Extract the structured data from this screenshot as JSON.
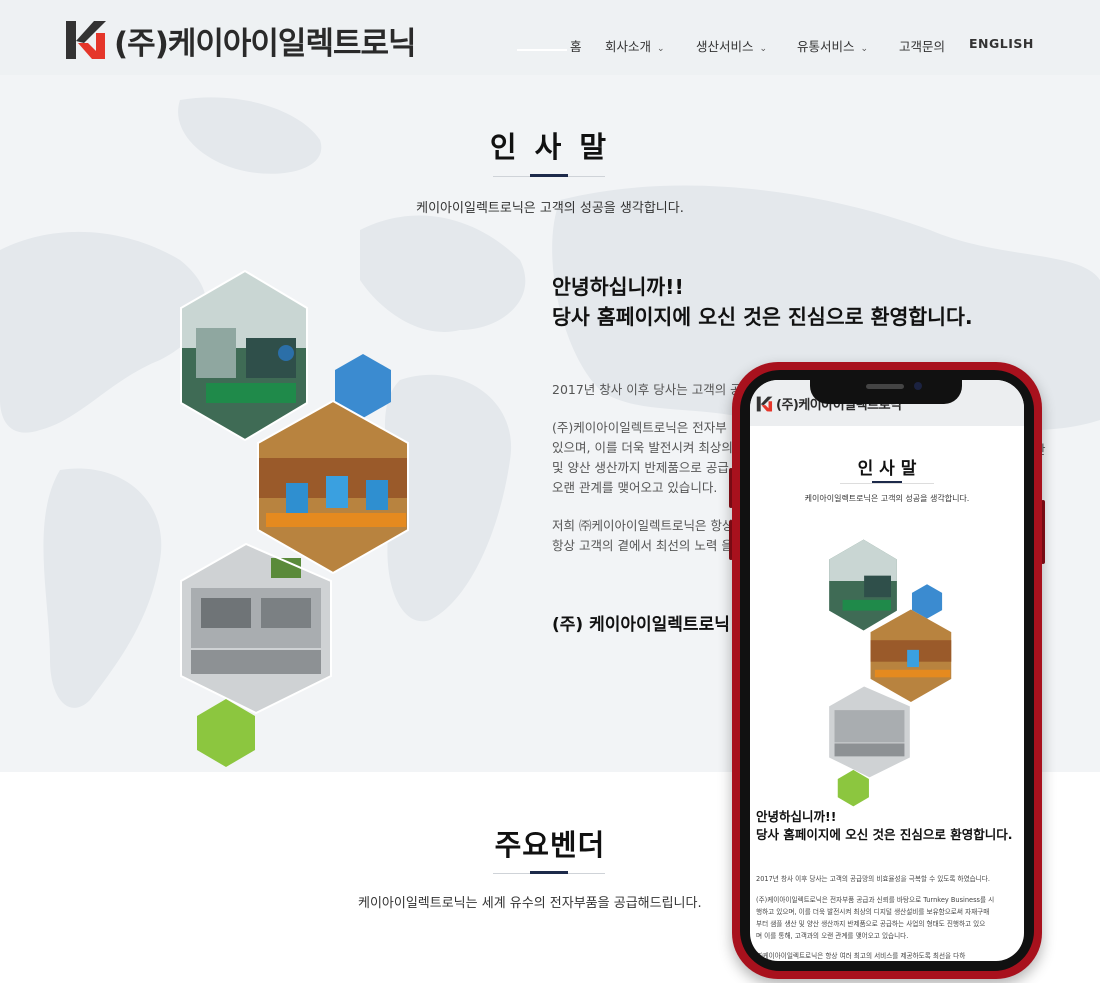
{
  "header": {
    "logo_text": "(주)케이아이일렉트로닉",
    "nav": [
      {
        "label": "홈"
      },
      {
        "label": "회사소개"
      },
      {
        "label": "생산서비스"
      },
      {
        "label": "유통서비스"
      },
      {
        "label": "고객문의"
      },
      {
        "label": "ENGLISH"
      }
    ]
  },
  "greeting_section": {
    "title": "인 사 말",
    "subtitle": "케이아이일렉트로닉은 고객의 성공을 생각합니다.",
    "headline_1": "안녕하십니까!!",
    "headline_2": "당사 홈페이지에 오신 것은 진심으로 환영합니다.",
    "para_1": "2017년 창사 이후 당사는 고객의 공",
    "para_2_l1": "(주)케이아이일렉트로닉은 전자부",
    "para_2_l2": "있으며, 이를 더욱 발전시켜 최상의",
    "para_2_l3": "및 양산 생산까지 반제품으로 공급",
    "para_2_l4": "오랜 관계를 맺어오고 있습니다.",
    "para_3_l1": "저희 ㈜케이아이일렉트로닉은 항상",
    "para_3_l2": "항상 고객의 곁에서 최선의 노력 을",
    "signature": "(주) 케이아이일렉트로닉",
    "phone_edge_right": "산"
  },
  "vendors_section": {
    "title": "주요벤더",
    "subtitle": "케이아이일렉트로닉는 세계 유수의 전자부품을 공급해드립니다."
  },
  "mobile_preview": {
    "logo_text": "(주)케이아이일렉트로닉",
    "title": "인 사 말",
    "subtitle": "케이아이일렉트로닉은 고객의 성공을 생각합니다.",
    "headline_1": "안녕하십니까!!",
    "headline_2": "당사 홈페이지에 오신 것은 진심으로 환영합니다.",
    "para_1": "2017년 창사 이후 당사는 고객의 공급망의 비효율성을 극복할 수 있도록 하였습니다.",
    "para_2_l1": "(주)케이아이일렉트로닉은 전자부품 공급과 신뢰를 바탕으로 Turnkey Business를 시",
    "para_2_l2": "행하고 있으며, 이를 더욱 발전시켜 최상의 디지털 생산설비를 보유함으로써 자재구매",
    "para_2_l3": "부터 샘플 생산 및 양산 생산까지 반제품으로 공급하는 사업의 형태도 진행하고 있으",
    "para_2_l4": "며 이를 통해, 고객과의 오랜 관계를 맺어오고 있습니다.",
    "para_3_l1": "㈜케이아이일렉트로닉은 항상 여러 최고의 서비스를 제공하도록 최선을 다하"
  },
  "colors": {
    "accent_navy": "#1d2a4a",
    "hex_blue": "#3b8bd0",
    "hex_green": "#8cc63f",
    "phone_frame": "#a8111d"
  }
}
